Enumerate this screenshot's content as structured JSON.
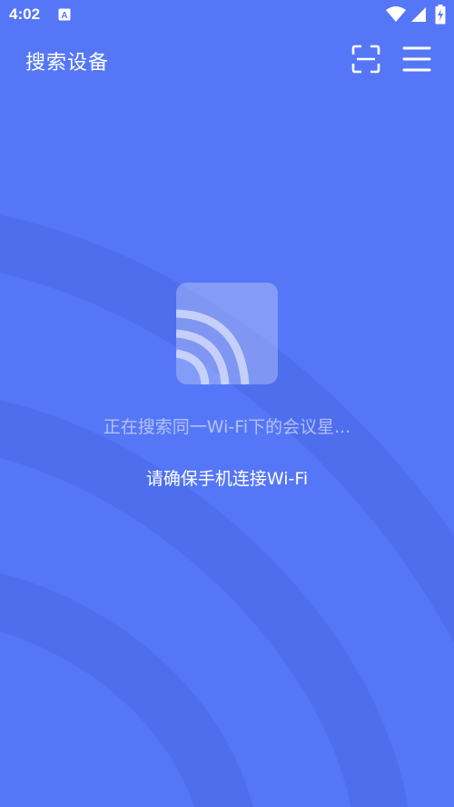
{
  "status_bar": {
    "time": "4:02",
    "notification_icon": "a-box-icon",
    "icons": [
      "wifi-icon",
      "signal-icon",
      "battery-charging-icon"
    ]
  },
  "header": {
    "title": "搜索设备",
    "scan_icon": "scan-icon",
    "menu_icon": "menu-icon"
  },
  "main": {
    "device_icon": "cast-wifi-icon",
    "searching_text": "正在搜索同一Wi-Fi下的会议星...",
    "hint_text": "请确保手机连接Wi-Fi"
  },
  "colors": {
    "background": "#5577F7",
    "arc_shade": "#4C6CF0",
    "text_primary": "#FFFFFF"
  }
}
